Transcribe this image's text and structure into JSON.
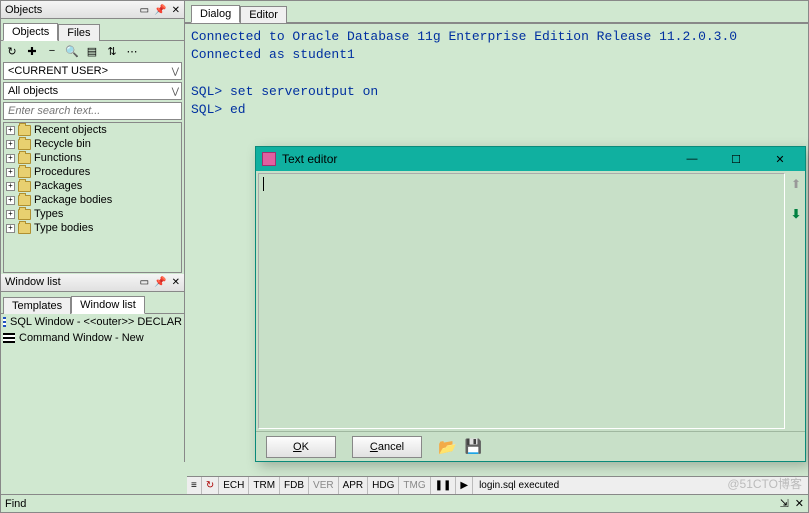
{
  "left": {
    "objects_panel_title": "Objects",
    "tabs": {
      "objects": "Objects",
      "files": "Files"
    },
    "user_dropdown": "<CURRENT USER>",
    "filter_dropdown": "All objects",
    "search_placeholder": "Enter search text...",
    "tree_items": [
      "Recent objects",
      "Recycle bin",
      "Functions",
      "Procedures",
      "Packages",
      "Package bodies",
      "Types",
      "Type bodies"
    ],
    "window_list_title": "Window list",
    "wl_tabs": {
      "templates": "Templates",
      "windowlist": "Window list"
    },
    "wl_items": [
      "SQL Window - <<outer>> DECLAR",
      "Command Window - New"
    ]
  },
  "right": {
    "tabs": {
      "dialog": "Dialog",
      "editor": "Editor"
    },
    "console_text": "Connected to Oracle Database 11g Enterprise Edition Release 11.2.0.3.0\nConnected as student1\n\nSQL> set serveroutput on\nSQL> ed"
  },
  "popup": {
    "title": "Text editor",
    "ok_prefix": "O",
    "ok_rest": "K",
    "cancel_prefix": "C",
    "cancel_rest": "ancel"
  },
  "bottom": {
    "segs": [
      "ECH",
      "TRM",
      "FDB",
      "VER",
      "APR",
      "HDG",
      "TMG"
    ],
    "status": "login.sql executed"
  },
  "footer": {
    "left": "Find",
    "watermark": "@51CTO博客"
  }
}
